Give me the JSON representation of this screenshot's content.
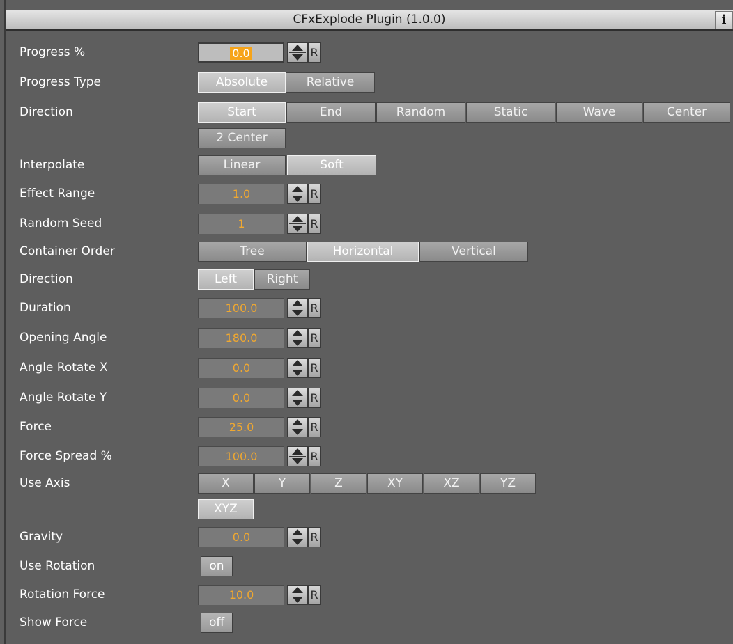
{
  "window": {
    "title": "CFxExplode Plugin (1.0.0)",
    "info_label": "i"
  },
  "progress": {
    "label": "Progress %",
    "value": "0.0",
    "reset": "R"
  },
  "progress_type": {
    "label": "Progress Type",
    "options": [
      "Absolute",
      "Relative"
    ],
    "selected": "Absolute"
  },
  "direction": {
    "label": "Direction",
    "options": [
      "Start",
      "End",
      "Random",
      "Static",
      "Wave",
      "Center",
      "2 Center"
    ],
    "selected": "Start"
  },
  "interpolate": {
    "label": "Interpolate",
    "options": [
      "Linear",
      "Soft"
    ],
    "selected": "Soft"
  },
  "effect_range": {
    "label": "Effect Range",
    "value": "1.0",
    "reset": "R"
  },
  "random_seed": {
    "label": "Random Seed",
    "value": "1",
    "reset": "R"
  },
  "container_order": {
    "label": "Container Order",
    "options": [
      "Tree",
      "Horizontal",
      "Vertical"
    ],
    "selected": "Horizontal"
  },
  "direction2": {
    "label": "Direction",
    "options": [
      "Left",
      "Right"
    ],
    "selected": "Left"
  },
  "duration": {
    "label": "Duration",
    "value": "100.0",
    "reset": "R"
  },
  "opening_angle": {
    "label": "Opening Angle",
    "value": "180.0",
    "reset": "R"
  },
  "angle_rotate_x": {
    "label": "Angle Rotate X",
    "value": "0.0",
    "reset": "R"
  },
  "angle_rotate_y": {
    "label": "Angle Rotate Y",
    "value": "0.0",
    "reset": "R"
  },
  "force": {
    "label": "Force",
    "value": "25.0",
    "reset": "R"
  },
  "force_spread": {
    "label": "Force Spread %",
    "value": "100.0",
    "reset": "R"
  },
  "use_axis": {
    "label": "Use Axis",
    "options": [
      "X",
      "Y",
      "Z",
      "XY",
      "XZ",
      "YZ",
      "XYZ"
    ],
    "selected": "XYZ"
  },
  "gravity": {
    "label": "Gravity",
    "value": "0.0",
    "reset": "R"
  },
  "use_rotation": {
    "label": "Use Rotation",
    "value": "on"
  },
  "rotation_force": {
    "label": "Rotation Force",
    "value": "10.0",
    "reset": "R"
  },
  "show_force": {
    "label": "Show Force",
    "value": "off"
  }
}
